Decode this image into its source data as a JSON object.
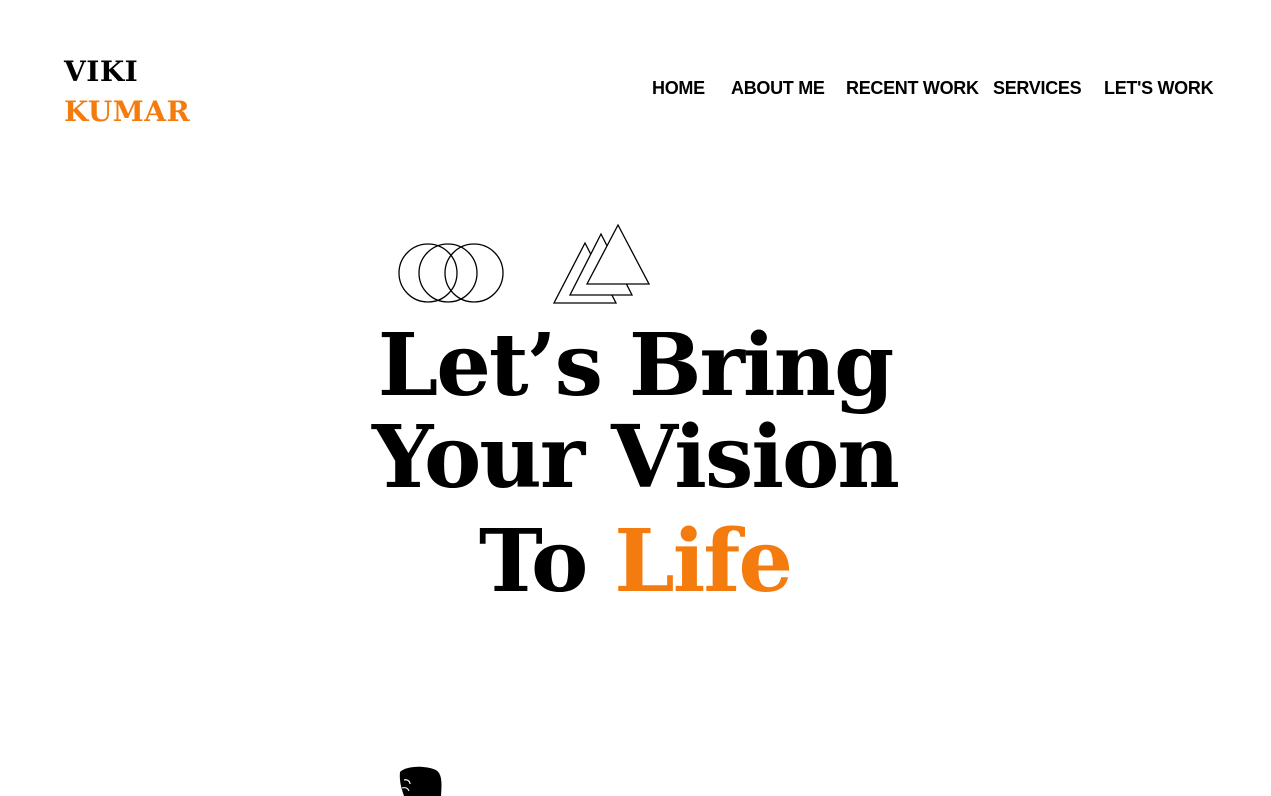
{
  "brand": {
    "line1": "VIKI",
    "line2": "KUMAR"
  },
  "nav": {
    "items": [
      "HOME",
      "ABOUT ME",
      "RECENT WORK",
      "SERVICES",
      "LET'S WORK"
    ]
  },
  "hero": {
    "line1": "Let’s Bring",
    "line2": "Your Vision",
    "line3_prefix": "To",
    "line3_accent": "Life"
  },
  "decor": {
    "circles_icon": "overlapping-circles-icon",
    "triangles_icon": "stacked-triangles-icon"
  },
  "colors": {
    "accent": "#f47c0f",
    "text": "#000000",
    "background": "#ffffff"
  }
}
